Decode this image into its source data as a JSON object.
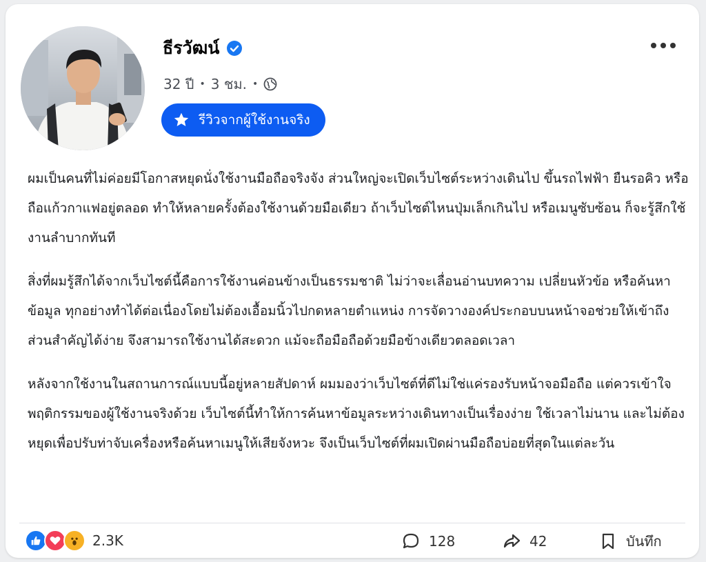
{
  "post": {
    "author": "ธีรวัฒน์",
    "meta": {
      "age": "32 ปี",
      "time": "3 ชม."
    },
    "badge_label": "รีวิวจากผู้ใช้งานจริง",
    "paragraphs": [
      "ผมเป็นคนที่ไม่ค่อยมีโอกาสหยุดนั่งใช้งานมือถือจริงจัง ส่วนใหญ่จะเปิดเว็บไซต์ระหว่างเดินไป ขึ้นรถไฟฟ้า ยืนรอคิว หรือถือแก้วกาแฟอยู่ตลอด ทำให้หลายครั้งต้องใช้งานด้วยมือเดียว ถ้าเว็บไซต์ไหนปุ่มเล็กเกินไป หรือเมนูซับซ้อน ก็จะรู้สึกใช้งานลำบากทันที",
      "สิ่งที่ผมรู้สึกได้จากเว็บไซต์นี้คือการใช้งานค่อนข้างเป็นธรรมชาติ ไม่ว่าจะเลื่อนอ่านบทความ เปลี่ยนหัวข้อ หรือค้นหาข้อมูล ทุกอย่างทำได้ต่อเนื่องโดยไม่ต้องเอื้อมนิ้วไปกดหลายตำแหน่ง การจัดวางองค์ประกอบบนหน้าจอช่วยให้เข้าถึงส่วนสำคัญได้ง่าย จึงสามารถใช้งานได้สะดวก แม้จะถือมือถือด้วยมือข้างเดียวตลอดเวลา",
      "หลังจากใช้งานในสถานการณ์แบบนี้อยู่หลายสัปดาห์ ผมมองว่าเว็บไซต์ที่ดีไม่ใช่แค่รองรับหน้าจอมือถือ แต่ควรเข้าใจพฤติกรรมของผู้ใช้งานจริงด้วย เว็บไซต์นี้ทำให้การค้นหาข้อมูลระหว่างเดินทางเป็นเรื่องง่าย ใช้เวลาไม่นาน และไม่ต้องหยุดเพื่อปรับท่าจับเครื่องหรือค้นหาเมนูให้เสียจังหวะ จึงเป็นเว็บไซต์ที่ผมเปิดผ่านมือถือบ่อยที่สุดในแต่ละวัน"
    ],
    "reactions_count": "2.3K",
    "comments_count": "128",
    "shares_count": "42",
    "save_label": "บันทึก"
  },
  "colors": {
    "accent": "#0d5cf2",
    "like": "#1877f2",
    "love": "#f33e58",
    "wow": "#f7b125"
  },
  "icons": [
    "verified-icon",
    "globe-icon",
    "star-icon",
    "more-icon",
    "like-icon",
    "love-icon",
    "wow-icon",
    "comment-icon",
    "share-icon",
    "bookmark-icon"
  ]
}
